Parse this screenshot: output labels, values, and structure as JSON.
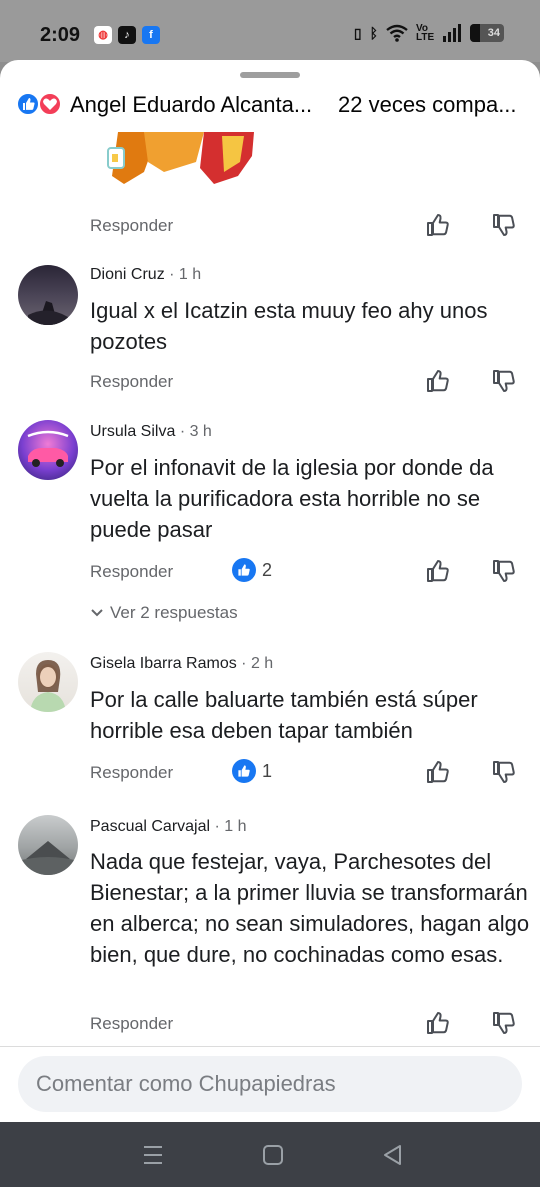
{
  "status_bar": {
    "time": "2:09",
    "battery": "34",
    "network": "Vo LTE"
  },
  "header": {
    "title": "Angel Eduardo Alcanta...",
    "shares": "22 veces compa..."
  },
  "reply_label": "Responder",
  "comments": [
    {
      "name": "Dioni Cruz",
      "time": "· 1 h",
      "text": "Igual x el Icatzin esta muuy feo ahy unos pozotes"
    },
    {
      "name": "Ursula Silva",
      "time": "· 3 h",
      "text": "Por el infonavit de la iglesia por donde da vuelta la purificadora esta horrible no se puede pasar",
      "likes": "2",
      "replies": "Ver 2 respuestas"
    },
    {
      "name": "Gisela Ibarra Ramos",
      "time": "· 2 h",
      "text": "Por la calle baluarte también está súper horrible esa deben tapar también",
      "likes": "1"
    },
    {
      "name": "Pascual Carvajal",
      "time": "· 1 h",
      "text": "Nada que festejar, vaya, Parchesotes del Bienestar; a la primer lluvia se transformarán en alberca; no sean simuladores, hagan algo bien, que dure, no cochinadas como esas."
    }
  ],
  "compose": {
    "placeholder": "Comentar como Chupapiedras"
  },
  "colors": {
    "like_blue": "#1877f2",
    "love_red": "#f33e58",
    "secondary_text": "#65676b"
  }
}
